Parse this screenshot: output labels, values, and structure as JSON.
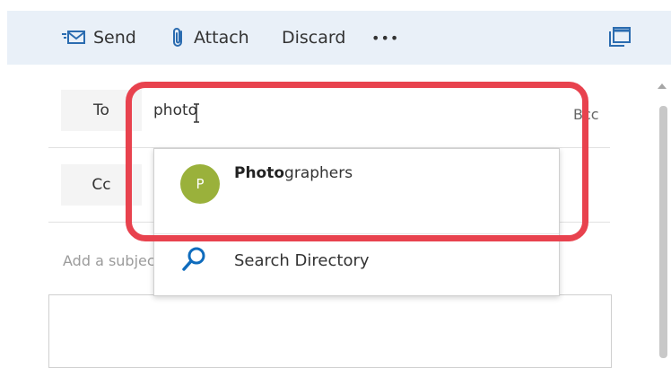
{
  "toolbar": {
    "send_label": "Send",
    "attach_label": "Attach",
    "discard_label": "Discard",
    "more_label": "•••",
    "popout_icon": "popout-icon"
  },
  "compose": {
    "to_button": "To",
    "cc_button": "Cc",
    "to_value": "photo",
    "bcc_label": "Bcc",
    "subject_placeholder": "Add a subject"
  },
  "suggestions": {
    "items": [
      {
        "initial": "P",
        "name_match": "Photo",
        "name_rest": "graphers",
        "avatar_color": "#9ab13b"
      }
    ],
    "search_directory_label": "Search Directory"
  },
  "colors": {
    "toolbar_bg": "#e9f0f8",
    "accent": "#0f6cbd",
    "highlight": "#e8424e"
  }
}
